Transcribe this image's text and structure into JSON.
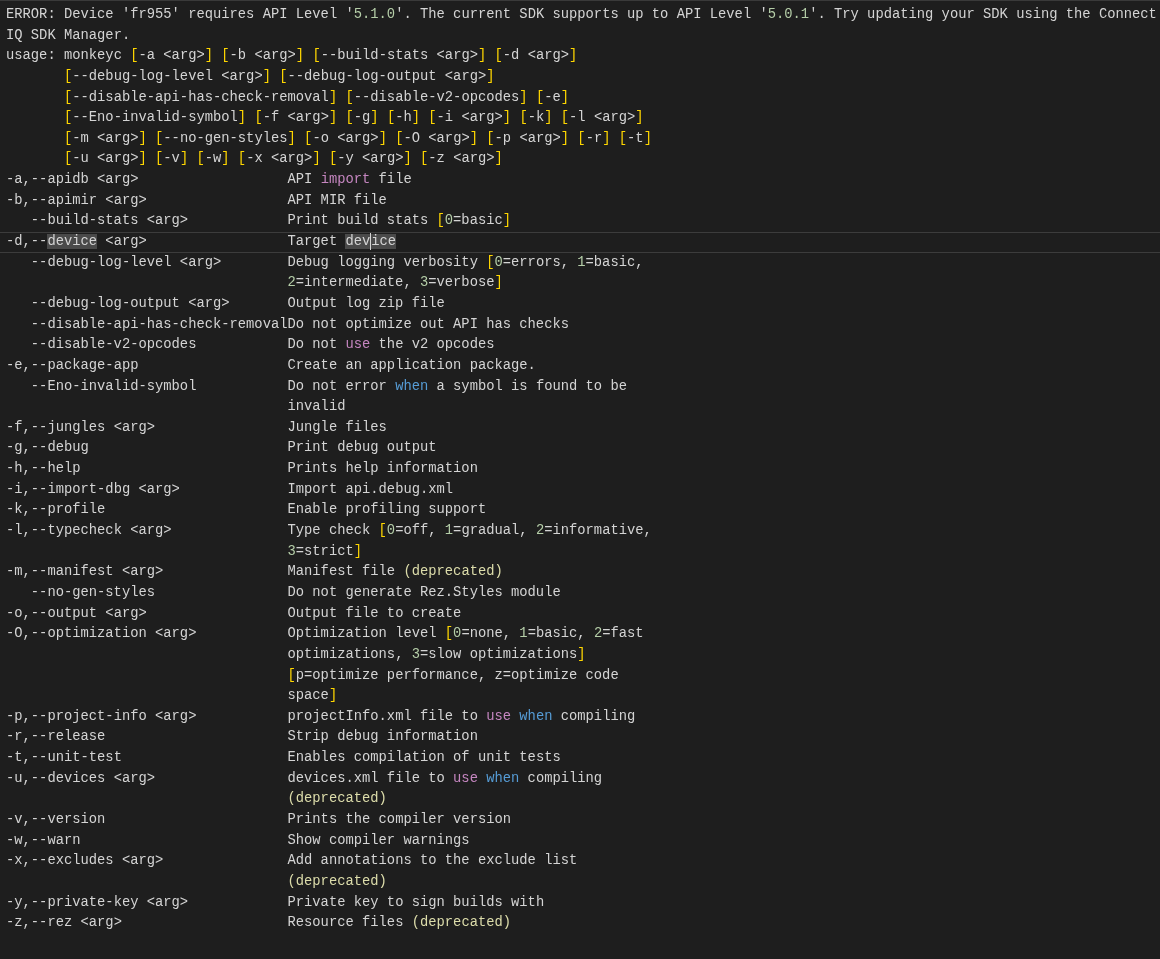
{
  "message": [
    {
      "indented": false,
      "segments": [
        "ERROR: Device 'fr955' requires API Level '",
        {
          "text": "5.1.0",
          "kind": "number"
        },
        "'. The current SDK supports up to API Level '",
        {
          "text": "5.0.1",
          "kind": "number"
        },
        "'. Try updating your SDK using the Connect"
      ]
    },
    {
      "indented": false,
      "segments": [
        "IQ SDK Manager."
      ]
    }
  ],
  "usage": [
    {
      "indented": false,
      "segments": [
        "usage: monkeyc ",
        {
          "text": "[",
          "kind": "bracket"
        },
        "-a <arg>",
        {
          "text": "] [",
          "kind": "bracket"
        },
        "-b <arg>",
        {
          "text": "] [",
          "kind": "bracket"
        },
        "--build-stats <arg>",
        {
          "text": "] [",
          "kind": "bracket"
        },
        "-d <arg>",
        {
          "text": "]",
          "kind": "bracket"
        }
      ]
    },
    {
      "indented": true,
      "segments": [
        {
          "text": "[",
          "kind": "bracket"
        },
        "--debug-log-level <arg>",
        {
          "text": "] [",
          "kind": "bracket"
        },
        "--debug-log-output <arg>",
        {
          "text": "]",
          "kind": "bracket"
        }
      ]
    },
    {
      "indented": true,
      "segments": [
        {
          "text": "[",
          "kind": "bracket"
        },
        "--disable-api-has-check-removal",
        {
          "text": "] [",
          "kind": "bracket"
        },
        "--disable-v2-opcodes",
        {
          "text": "] [",
          "kind": "bracket"
        },
        "-e",
        {
          "text": "]",
          "kind": "bracket"
        }
      ]
    },
    {
      "indented": true,
      "segments": [
        {
          "text": "[",
          "kind": "bracket"
        },
        "--Eno-invalid-symbol",
        {
          "text": "] [",
          "kind": "bracket"
        },
        "-f <arg>",
        {
          "text": "] [",
          "kind": "bracket"
        },
        "-g",
        {
          "text": "] [",
          "kind": "bracket"
        },
        "-h",
        {
          "text": "] [",
          "kind": "bracket"
        },
        "-i <arg>",
        {
          "text": "] [",
          "kind": "bracket"
        },
        "-k",
        {
          "text": "] [",
          "kind": "bracket"
        },
        "-l <arg>",
        {
          "text": "]",
          "kind": "bracket"
        }
      ]
    },
    {
      "indented": true,
      "segments": [
        {
          "text": "[",
          "kind": "bracket"
        },
        "-m <arg>",
        {
          "text": "] [",
          "kind": "bracket"
        },
        "--no-gen-styles",
        {
          "text": "] [",
          "kind": "bracket"
        },
        "-o <arg>",
        {
          "text": "] [",
          "kind": "bracket"
        },
        "-O <arg>",
        {
          "text": "] [",
          "kind": "bracket"
        },
        "-p <arg>",
        {
          "text": "] [",
          "kind": "bracket"
        },
        "-r",
        {
          "text": "] [",
          "kind": "bracket"
        },
        "-t",
        {
          "text": "]",
          "kind": "bracket"
        }
      ]
    },
    {
      "indented": true,
      "segments": [
        {
          "text": "[",
          "kind": "bracket"
        },
        "-u <arg>",
        {
          "text": "] [",
          "kind": "bracket"
        },
        "-v",
        {
          "text": "] [",
          "kind": "bracket"
        },
        "-w",
        {
          "text": "] [",
          "kind": "bracket"
        },
        "-x <arg>",
        {
          "text": "] [",
          "kind": "bracket"
        },
        "-y <arg>",
        {
          "text": "] [",
          "kind": "bracket"
        },
        "-z <arg>",
        {
          "text": "]",
          "kind": "bracket"
        }
      ]
    }
  ],
  "options": [
    {
      "indented": false,
      "current": false,
      "flag": [
        "-a,--apidb <arg>"
      ],
      "description": [
        [
          "API ",
          {
            "text": "import",
            "kind": "keyword"
          },
          " file"
        ]
      ]
    },
    {
      "indented": false,
      "current": false,
      "flag": [
        "-b,--apimir <arg>"
      ],
      "description": [
        [
          "API MIR file"
        ]
      ]
    },
    {
      "indented": true,
      "current": false,
      "flag": [
        "--build-stats <arg>"
      ],
      "description": [
        [
          "Print build stats ",
          {
            "text": "[",
            "kind": "bracket"
          },
          {
            "text": "0",
            "kind": "number"
          },
          "=basic",
          {
            "text": "]",
            "kind": "bracket"
          }
        ]
      ]
    },
    {
      "indented": false,
      "current": true,
      "flag": [
        "-d,--",
        {
          "text": "device",
          "kind": "match"
        },
        " <arg>"
      ],
      "description": [
        [
          "Target ",
          {
            "text": "dev",
            "kind": "match"
          },
          {
            "text": "ice",
            "kind": "match",
            "caret_before": true
          }
        ]
      ]
    },
    {
      "indented": true,
      "current": false,
      "flag": [
        "--debug-log-level <arg>"
      ],
      "description": [
        [
          "Debug logging verbosity ",
          {
            "text": "[",
            "kind": "bracket"
          },
          {
            "text": "0",
            "kind": "number"
          },
          "=errors, ",
          {
            "text": "1",
            "kind": "number"
          },
          "=basic,"
        ],
        [
          {
            "text": "2",
            "kind": "number"
          },
          "=intermediate, ",
          {
            "text": "3",
            "kind": "number"
          },
          "=verbose",
          {
            "text": "]",
            "kind": "bracket"
          }
        ]
      ]
    },
    {
      "indented": true,
      "current": false,
      "flag": [
        "--debug-log-output <arg>"
      ],
      "description": [
        [
          "Output log zip file"
        ]
      ]
    },
    {
      "indented": true,
      "current": false,
      "flag": [
        "--disable-api-has-check-removal"
      ],
      "description": [
        [
          "Do not optimize out API has checks"
        ]
      ]
    },
    {
      "indented": true,
      "current": false,
      "flag": [
        "--disable-v2-opcodes"
      ],
      "description": [
        [
          "Do not ",
          {
            "text": "use",
            "kind": "keyword"
          },
          " the v2 opcodes"
        ]
      ]
    },
    {
      "indented": false,
      "current": false,
      "flag": [
        "-e,--package-app"
      ],
      "description": [
        [
          "Create an application package."
        ]
      ]
    },
    {
      "indented": true,
      "current": false,
      "flag": [
        "--Eno-invalid-symbol"
      ],
      "description": [
        [
          "Do not error ",
          {
            "text": "when",
            "kind": "control"
          },
          " a symbol is found to be"
        ],
        [
          "invalid"
        ]
      ]
    },
    {
      "indented": false,
      "current": false,
      "flag": [
        "-f,--jungles <arg>"
      ],
      "description": [
        [
          "Jungle files"
        ]
      ]
    },
    {
      "indented": false,
      "current": false,
      "flag": [
        "-g,--debug"
      ],
      "description": [
        [
          "Print debug output"
        ]
      ]
    },
    {
      "indented": false,
      "current": false,
      "flag": [
        "-h,--help"
      ],
      "description": [
        [
          "Prints help information"
        ]
      ]
    },
    {
      "indented": false,
      "current": false,
      "flag": [
        "-i,--import-dbg <arg>"
      ],
      "description": [
        [
          "Import api.debug.xml"
        ]
      ]
    },
    {
      "indented": false,
      "current": false,
      "flag": [
        "-k,--profile"
      ],
      "description": [
        [
          "Enable profiling support"
        ]
      ]
    },
    {
      "indented": false,
      "current": false,
      "flag": [
        "-l,--typecheck <arg>"
      ],
      "description": [
        [
          "Type check ",
          {
            "text": "[",
            "kind": "bracket"
          },
          {
            "text": "0",
            "kind": "number"
          },
          "=off, ",
          {
            "text": "1",
            "kind": "number"
          },
          "=gradual, ",
          {
            "text": "2",
            "kind": "number"
          },
          "=informative,"
        ],
        [
          {
            "text": "3",
            "kind": "number"
          },
          "=strict",
          {
            "text": "]",
            "kind": "bracket"
          }
        ]
      ]
    },
    {
      "indented": false,
      "current": false,
      "flag": [
        "-m,--manifest <arg>"
      ],
      "description": [
        [
          "Manifest file ",
          {
            "text": "(deprecated)",
            "kind": "deprecated"
          }
        ]
      ]
    },
    {
      "indented": true,
      "current": false,
      "flag": [
        "--no-gen-styles"
      ],
      "description": [
        [
          "Do not generate Rez.Styles module"
        ]
      ]
    },
    {
      "indented": false,
      "current": false,
      "flag": [
        "-o,--output <arg>"
      ],
      "description": [
        [
          "Output file to create"
        ]
      ]
    },
    {
      "indented": false,
      "current": false,
      "flag": [
        "-O,--optimization <arg>"
      ],
      "description": [
        [
          "Optimization level ",
          {
            "text": "[",
            "kind": "bracket"
          },
          {
            "text": "0",
            "kind": "number"
          },
          "=none, ",
          {
            "text": "1",
            "kind": "number"
          },
          "=basic, ",
          {
            "text": "2",
            "kind": "number"
          },
          "=fast"
        ],
        [
          "optimizations, ",
          {
            "text": "3",
            "kind": "number"
          },
          "=slow optimizations",
          {
            "text": "]",
            "kind": "bracket"
          }
        ],
        [
          {
            "text": "[",
            "kind": "bracket"
          },
          "p=optimize performance, z=optimize code"
        ],
        [
          "space",
          {
            "text": "]",
            "kind": "bracket"
          }
        ]
      ]
    },
    {
      "indented": false,
      "current": false,
      "flag": [
        "-p,--project-info <arg>"
      ],
      "description": [
        [
          "projectInfo.xml file to ",
          {
            "text": "use",
            "kind": "keyword"
          },
          {
            "text": " when",
            "kind": "control"
          },
          " compiling"
        ]
      ]
    },
    {
      "indented": false,
      "current": false,
      "flag": [
        "-r,--release"
      ],
      "description": [
        [
          "Strip debug information"
        ]
      ]
    },
    {
      "indented": false,
      "current": false,
      "flag": [
        "-t,--unit-test"
      ],
      "description": [
        [
          "Enables compilation of unit tests"
        ]
      ]
    },
    {
      "indented": false,
      "current": false,
      "flag": [
        "-u,--devices <arg>"
      ],
      "description": [
        [
          "devices.xml file to ",
          {
            "text": "use",
            "kind": "keyword"
          },
          {
            "text": " when",
            "kind": "control"
          },
          " compiling"
        ],
        [
          {
            "text": "(deprecated)",
            "kind": "deprecated"
          }
        ]
      ]
    },
    {
      "indented": false,
      "current": false,
      "flag": [
        "-v,--version"
      ],
      "description": [
        [
          "Prints the compiler version"
        ]
      ]
    },
    {
      "indented": false,
      "current": false,
      "flag": [
        "-w,--warn"
      ],
      "description": [
        [
          "Show compiler warnings"
        ]
      ]
    },
    {
      "indented": false,
      "current": false,
      "flag": [
        "-x,--excludes <arg>"
      ],
      "description": [
        [
          "Add annotations to the exclude list"
        ],
        [
          {
            "text": "(deprecated)",
            "kind": "deprecated"
          }
        ]
      ]
    },
    {
      "indented": false,
      "current": false,
      "flag": [
        "-y,--private-key <arg>"
      ],
      "description": [
        [
          "Private key to sign builds with"
        ]
      ]
    },
    {
      "indented": false,
      "current": false,
      "flag": [
        "-z,--rez <arg>"
      ],
      "description": [
        [
          "Resource files ",
          {
            "text": "(deprecated)",
            "kind": "deprecated"
          }
        ]
      ]
    }
  ]
}
